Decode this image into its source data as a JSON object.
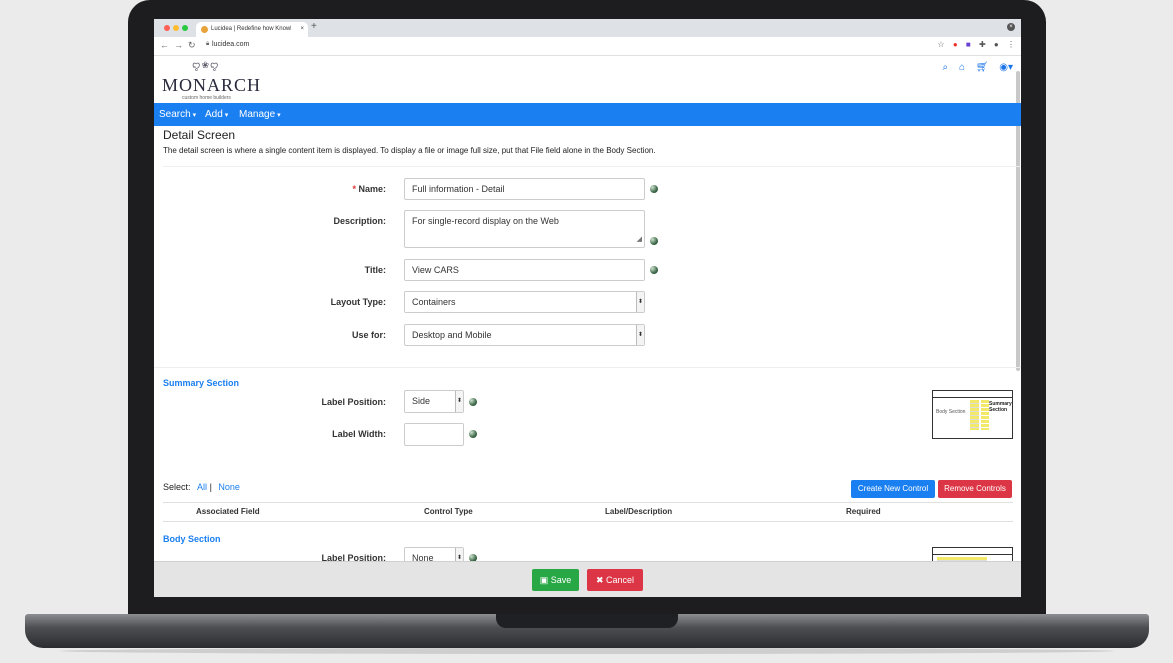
{
  "browser": {
    "tab_title": "Lucidea | Redefine how Knowle",
    "tab_close": "×",
    "new_tab": "+",
    "url": "lucidea.com"
  },
  "header": {
    "logo_art": "ꨄ❀ꨄ",
    "logo": "MONARCH",
    "logo_sub": "custom home builders"
  },
  "menu": {
    "search": "Search",
    "add": "Add",
    "manage": "Manage"
  },
  "page": {
    "title": "Detail Screen",
    "subtitle": "The detail screen is where a single content item is displayed. To display a file or image full size, put that File field alone in the Body Section."
  },
  "form": {
    "name_label": "Name:",
    "name_required_mark": "*",
    "name_value": "Full information - Detail",
    "description_label": "Description:",
    "description_value": "For single-record display on the Web",
    "title_label": "Title:",
    "title_value": "View CARS",
    "layout_type_label": "Layout Type:",
    "layout_type_value": "Containers",
    "use_for_label": "Use for:",
    "use_for_value": "Desktop and Mobile"
  },
  "summary_section": {
    "heading": "Summary Section",
    "label_position_label": "Label Position:",
    "label_position_value": "Side",
    "label_width_label": "Label Width:",
    "label_width_value": "",
    "thumb_body": "Body Section",
    "thumb_summary": "Summary Section"
  },
  "controls": {
    "select_label": "Select:",
    "all_link": "All",
    "separator": "|",
    "none_link": "None",
    "create_button": "Create New Control",
    "remove_button": "Remove Controls",
    "columns": [
      "Associated Field",
      "Control Type",
      "Label/Description",
      "Required"
    ]
  },
  "body_section": {
    "heading": "Body Section",
    "label_position_label": "Label Position:",
    "label_position_value": "None"
  },
  "footer": {
    "save_button": "Save",
    "cancel_button": "Cancel"
  },
  "colors": {
    "accent": "#1a7ff0",
    "save": "#28a745",
    "cancel": "#dc3545"
  }
}
